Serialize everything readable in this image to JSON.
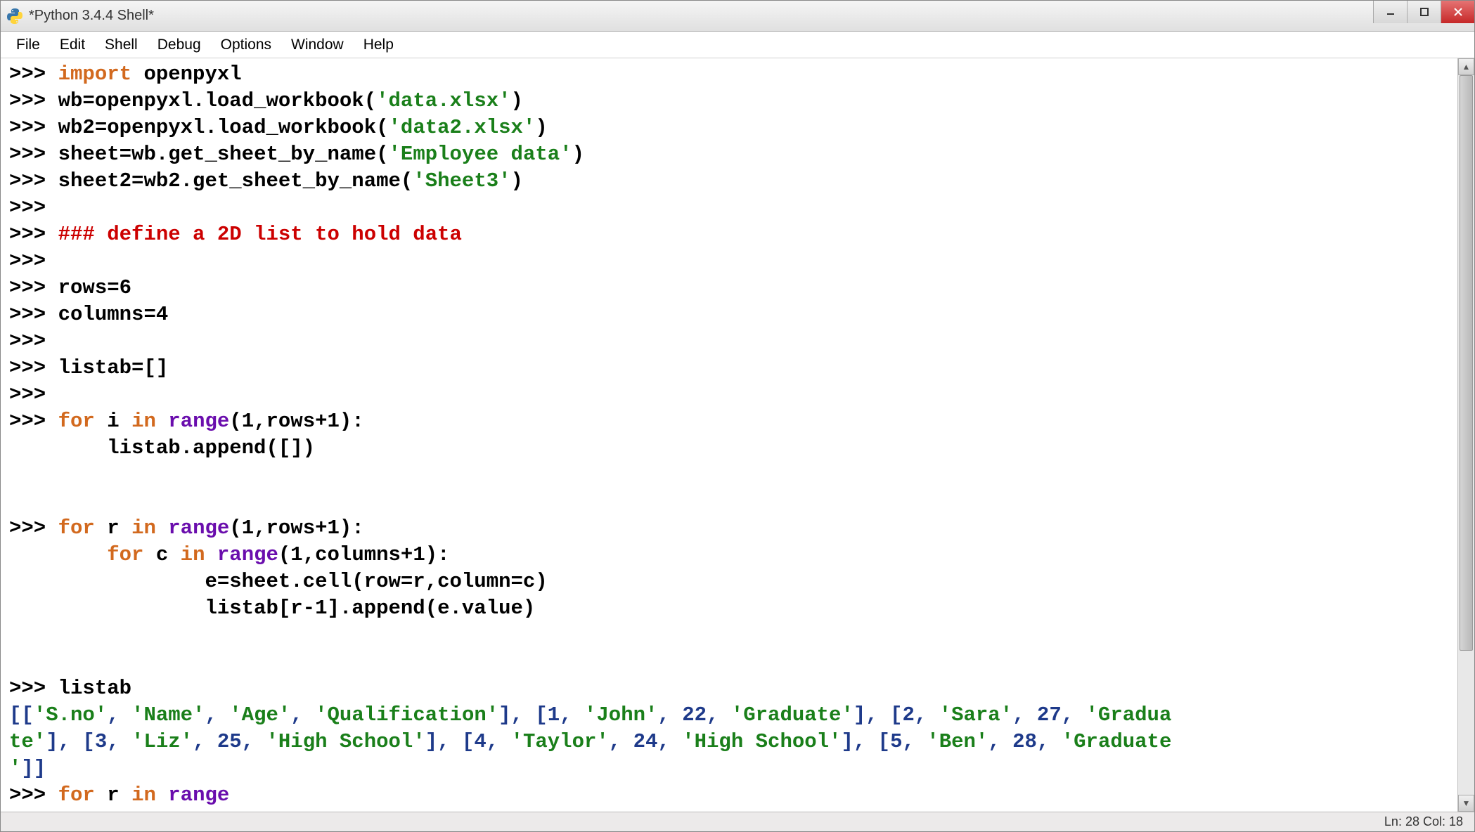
{
  "window": {
    "title": "*Python 3.4.4 Shell*"
  },
  "menu": {
    "file": "File",
    "edit": "Edit",
    "shell": "Shell",
    "debug": "Debug",
    "options": "Options",
    "window": "Window",
    "help": "Help"
  },
  "code": {
    "prompt": ">>> ",
    "l1_kw": "import",
    "l1_rest": " openpyxl",
    "l2a": "wb=openpyxl.load_workbook(",
    "l2s": "'data.xlsx'",
    "l2b": ")",
    "l3a": "wb2=openpyxl.load_workbook(",
    "l3s": "'data2.xlsx'",
    "l3b": ")",
    "l4a": "sheet=wb.get_sheet_by_name(",
    "l4s": "'Employee data'",
    "l4b": ")",
    "l5a": "sheet2=wb2.get_sheet_by_name(",
    "l5s": "'Sheet3'",
    "l5b": ")",
    "l8_comment": "### define a 2D list to hold data",
    "l10": "rows=6",
    "l11": "columns=4",
    "l13": "listab=[]",
    "l15_for": "for",
    "l15_mid": " i ",
    "l15_in": "in",
    "l15_range": " range",
    "l15_rest": "(1,rows+1):",
    "l16": "        listab.append([])",
    "l19_mid": " r ",
    "l19_rest": "(1,rows+1):",
    "l20_indent": "        ",
    "l20_mid": " c ",
    "l20_rest": "(1,columns+1):",
    "l21": "                e=sheet.cell(row=r,column=c)",
    "l22": "                listab[r-1].append(e.value)",
    "l25": "listab",
    "l26a": "[[",
    "l26s1": "'S.no'",
    "l26c": ", ",
    "l26s2": "'Name'",
    "l26s3": "'Age'",
    "l26s4": "'Qualification'",
    "l26b1": "], [1, ",
    "l26s5": "'John'",
    "l26n1": ", 22, ",
    "l26s6": "'Graduate'",
    "l26b2": "], [2, ",
    "l26s7": "'Sara'",
    "l26n2": ", 27, ",
    "l26s8": "'Gradua",
    "l27a": "te'",
    "l27b1": "], [3, ",
    "l27s1": "'Liz'",
    "l27n1": ", 25, ",
    "l27s2": "'High School'",
    "l27b2": "], [4, ",
    "l27s3": "'Taylor'",
    "l27n2": ", 24, ",
    "l27s4": "'High School'",
    "l27b3": "], [5, ",
    "l27s5": "'Ben'",
    "l27n3": ", 28, ",
    "l27s6": "'Graduate",
    "l28a": "'",
    "l28b": "]]",
    "l29_mid": " r ",
    "l29_rest": " range"
  },
  "status": {
    "line_col": "Ln: 28  Col: 18"
  }
}
